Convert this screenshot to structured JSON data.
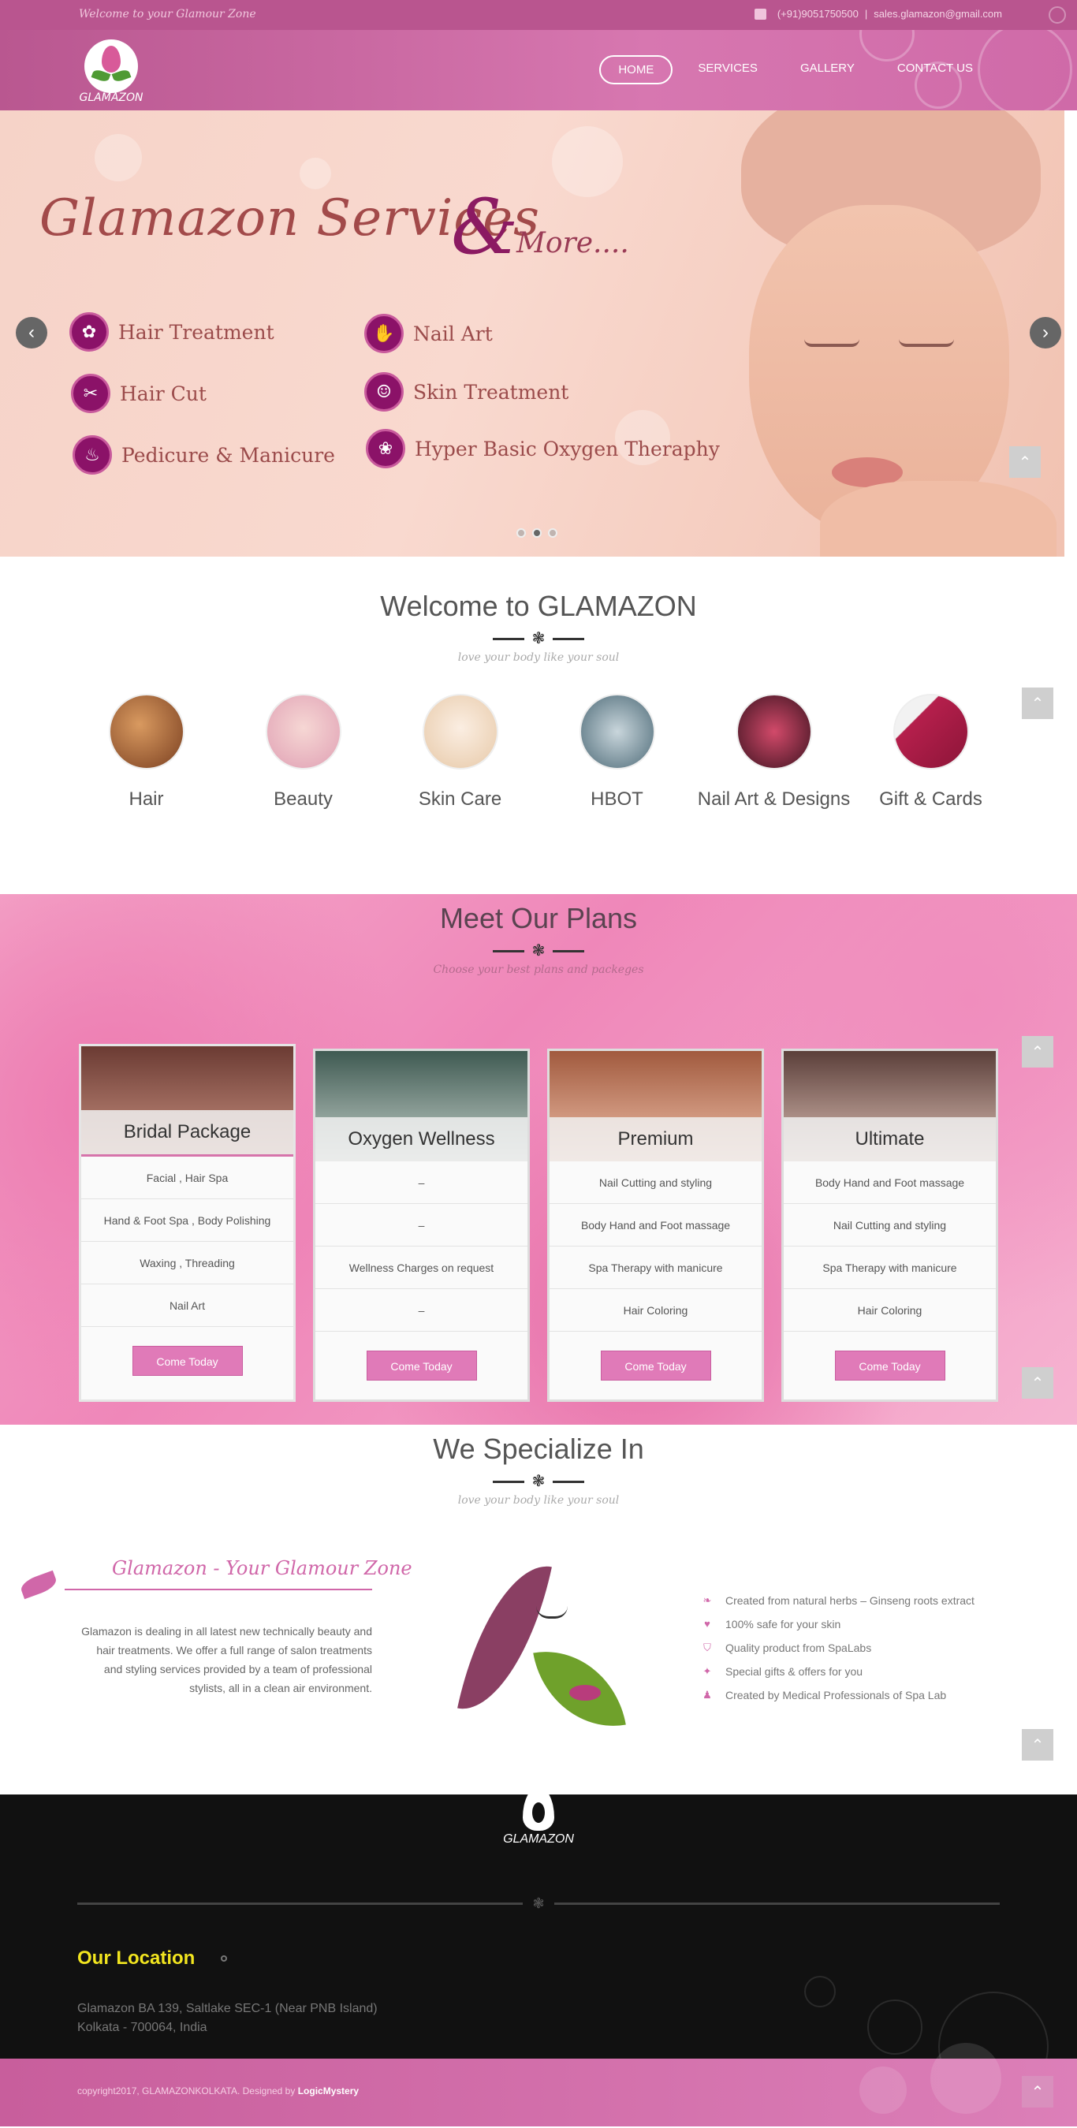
{
  "topbar": {
    "welcome": "Welcome to your Glamour Zone",
    "phone": "(+91)9051750500",
    "email": "sales.glamazon@gmail.com"
  },
  "header": {
    "logo_text": "GLAMAZON",
    "nav": [
      "HOME",
      "SERVICES",
      "GALLERY",
      "CONTACT US"
    ],
    "active": "HOME"
  },
  "hero": {
    "title": "Glamazon  Services",
    "amp": "&",
    "more": "More....",
    "services": [
      {
        "label": "Hair Treatment",
        "icon": "hair-treatment-icon"
      },
      {
        "label": "Nail Art",
        "icon": "nail-art-icon"
      },
      {
        "label": "Hair Cut",
        "icon": "scissors-icon"
      },
      {
        "label": "Skin Treatment",
        "icon": "face-icon"
      },
      {
        "label": "Pedicure & Manicure",
        "icon": "foot-icon"
      },
      {
        "label": "Hyper Basic Oxygen Theraphy",
        "icon": "lotus-icon"
      }
    ],
    "slides": 3,
    "active_slide": 2
  },
  "welcome": {
    "title": "Welcome to GLAMAZON",
    "tagline": "love your body like your soul",
    "categories": [
      {
        "label": "Hair",
        "color": "#b06a3a"
      },
      {
        "label": "Beauty",
        "color": "#e8b6c2"
      },
      {
        "label": "Skin Care",
        "color": "#f1ddc6"
      },
      {
        "label": "HBOT",
        "color": "#7c9aa6"
      },
      {
        "label": "Nail Art & Designs",
        "color": "#7a2c3e"
      },
      {
        "label": "Gift & Cards",
        "color": "#b51f4c"
      }
    ]
  },
  "plans": {
    "title": "Meet Our Plans",
    "tagline": "Choose your best plans and packeges",
    "cta": "Come Today",
    "items": [
      {
        "name": "Bridal Package",
        "color": "#a8706a",
        "rows": [
          "Facial , Hair Spa",
          "Hand & Foot Spa , Body Polishing",
          "Waxing , Threading",
          "Nail Art"
        ]
      },
      {
        "name": "Oxygen Wellness",
        "color": "#6d8c84",
        "rows": [
          "–",
          "–",
          "Wellness Charges on request",
          "–"
        ]
      },
      {
        "name": "Premium",
        "color": "#c9866e",
        "rows": [
          "Nail Cutting and styling",
          "Body Hand and Foot massage",
          "Spa Therapy with manicure",
          "Hair Coloring"
        ]
      },
      {
        "name": "Ultimate",
        "color": "#8a6a63",
        "rows": [
          "Body Hand and Foot massage",
          "Nail Cutting and styling",
          "Spa Therapy with manicure",
          "Hair Coloring"
        ]
      }
    ]
  },
  "special": {
    "title": "We Specialize In",
    "tagline": "love your body like your soul",
    "brand_title": "Glamazon - Your Glamour Zone",
    "description": "Glamazon is dealing in all latest new technically beauty and hair treatments. We offer a full range of salon treatments and styling services provided by a team of professional stylists, all in a clean air environment.",
    "features": [
      {
        "text": "Created from natural herbs – Ginseng roots extract",
        "icon": "leaf-icon",
        "glyph": "❧"
      },
      {
        "text": "100% safe for your skin",
        "icon": "heart-icon",
        "glyph": "♥"
      },
      {
        "text": "Quality product from SpaLabs",
        "icon": "shield-icon",
        "glyph": "⛉"
      },
      {
        "text": "Special gifts & offers for you",
        "icon": "gift-icon",
        "glyph": "✦"
      },
      {
        "text": "Created by Medical Professionals of Spa Lab",
        "icon": "doctor-icon",
        "glyph": "♟"
      }
    ]
  },
  "footer": {
    "logo_text": "GLAMAZON",
    "location_title": "Our Location",
    "address": "Glamazon BA 139, Saltlake SEC-1 (Near PNB Island) Kolkata - 700064, India",
    "copyright": "copyright2017, GLAMAZONKOLKATA. Designed by",
    "designer": "LogicMystery"
  },
  "colors": {
    "brand_pink": "#d777b0",
    "button_pink": "#e07ab8",
    "footer_bg": "#111111",
    "location_yellow": "#f2e51f"
  }
}
